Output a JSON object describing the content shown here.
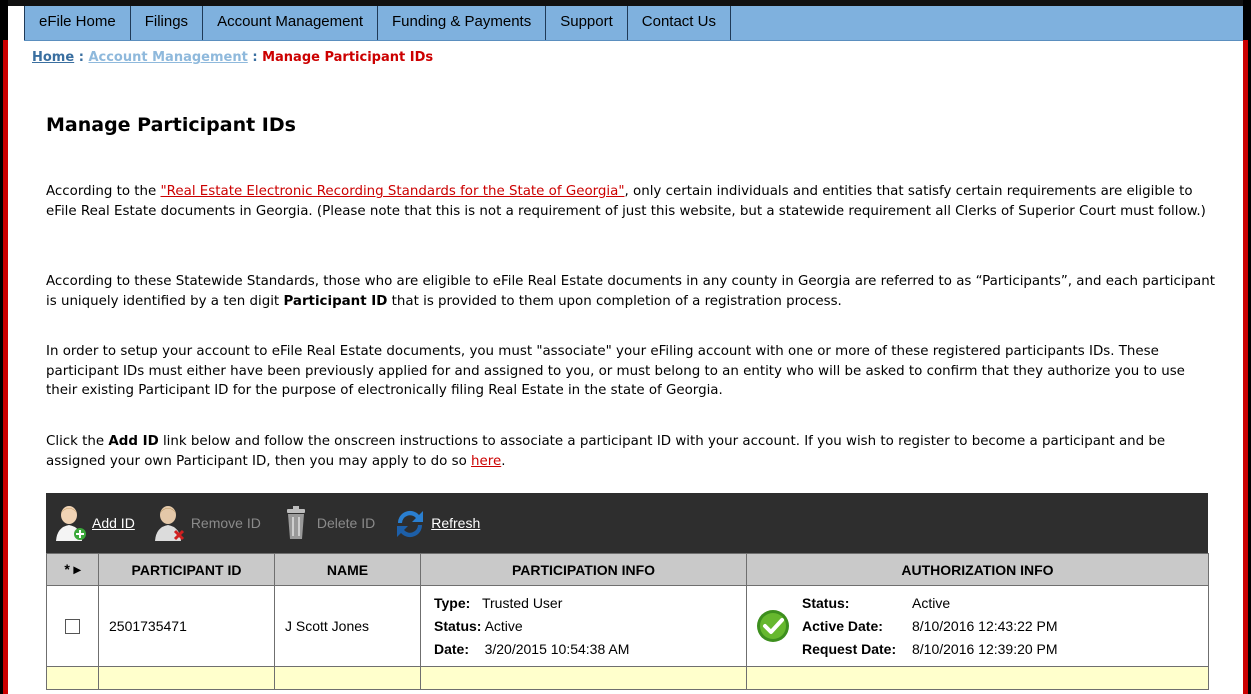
{
  "nav": {
    "items": [
      "eFile Home",
      "Filings",
      "Account Management",
      "Funding & Payments",
      "Support",
      "Contact Us"
    ]
  },
  "breadcrumb": {
    "home": "Home",
    "sep1": " : ",
    "account": "Account Management",
    "sep2": " : ",
    "current": "Manage Participant IDs"
  },
  "page": {
    "title": "Manage Participant IDs"
  },
  "paragraphs": {
    "p1_before": "According to the ",
    "p1_link": "\"Real Estate Electronic Recording Standards for the State of Georgia\"",
    "p1_after": ", only certain individuals and entities that satisfy certain requirements are eligible to eFile Real Estate documents in Georgia. (Please note that this is not a requirement of just this website, but a statewide requirement all Clerks of Superior Court must follow.)",
    "p2_before": "According to these Statewide Standards, those who are eligible to eFile Real Estate documents in any county in Georgia are referred to as “Participants”, and each participant is uniquely identified by a ten digit ",
    "p2_bold": "Participant ID",
    "p2_after": " that is provided to them upon completion of a registration process.",
    "p3": "In order to setup your account to eFile Real Estate documents, you must \"associate\" your eFiling account with one or more of these registered participants IDs. These participant IDs must either have been previously applied for and assigned to you, or must belong to an entity who will be asked to confirm that they authorize you to use their existing Participant ID for the purpose of electronically filing Real Estate in the state of Georgia.",
    "p4_before": "Click the ",
    "p4_bold": "Add ID",
    "p4_mid": " link below and follow the onscreen instructions to associate a participant ID with your account. If you wish to register to become a participant and be assigned your own Participant ID, then you may apply to do so ",
    "p4_link": "here",
    "p4_after": "."
  },
  "toolbar": {
    "add": "Add ID",
    "remove": "Remove ID",
    "delete": "Delete ID",
    "refresh": "Refresh"
  },
  "table": {
    "headers": [
      "* ▸",
      "PARTICIPANT ID",
      "NAME",
      "PARTICIPATION INFO",
      "AUTHORIZATION INFO"
    ],
    "rows": [
      {
        "participant_id": "2501735471",
        "name": "J Scott Jones",
        "type_label": "Type:",
        "type_value": "Trusted User",
        "status_label": "Status:",
        "status_value": "Active",
        "date_label": "Date:",
        "date_value": "3/20/2015 10:54:38 AM",
        "auth_status_label": "Status:",
        "auth_status_value": "Active",
        "active_date_label": "Active Date:",
        "active_date_value": "8/10/2016 12:43:22 PM",
        "request_date_label": "Request Date:",
        "request_date_value": "8/10/2016 12:39:20 PM"
      }
    ]
  },
  "colors": {
    "nav_bg": "#7fb1de",
    "accent_red": "#cc0000",
    "toolbar_bg": "#2e2e2e",
    "header_bg": "#c9c9c9",
    "alt_row": "#ffffcc"
  }
}
